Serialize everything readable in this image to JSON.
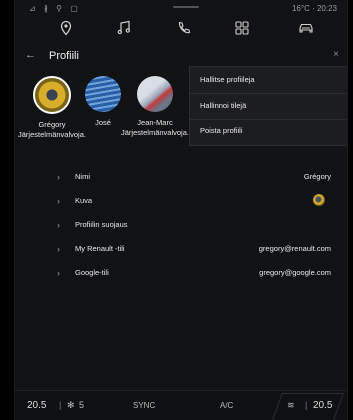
{
  "status": {
    "left": "⊿ ∦ ⚲ ▢",
    "temp_time": "16°C · 20:23"
  },
  "nav_icons": [
    "location-pin-icon",
    "music-icon",
    "phone-icon",
    "apps-grid-icon",
    "car-icon"
  ],
  "header": {
    "title": "Profiili"
  },
  "profiles": [
    {
      "name": "Grégory",
      "role": "Järjestelmänvalvoja."
    },
    {
      "name": "José",
      "role": ""
    },
    {
      "name": "Jean-Marc",
      "role": "Järjestelmänvalvoja."
    }
  ],
  "menu": {
    "items": [
      "Hallitse profiileja",
      "Hallinnoi tilejä",
      "Poista profiili"
    ]
  },
  "settings": [
    {
      "label": "Nimi",
      "value": "Grégory"
    },
    {
      "label": "Kuva",
      "value": ""
    },
    {
      "label": "Profiilin suojaus",
      "value": ""
    },
    {
      "label": "My Renault -tili",
      "value": "gregory@renault.com"
    },
    {
      "label": "Google-tili",
      "value": "gregory@google.com"
    }
  ],
  "bottom": {
    "left_temp": "20.5",
    "fan_level": "5",
    "sync": "SYNC",
    "ac": "A/C",
    "right_temp": "20.5"
  }
}
